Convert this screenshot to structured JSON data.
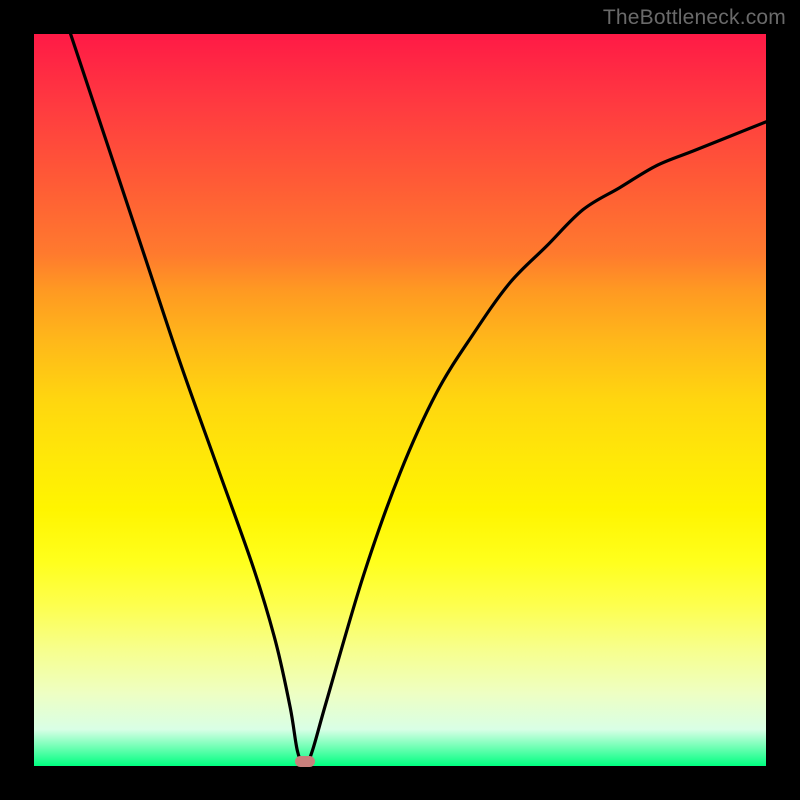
{
  "attribution": "TheBottleneck.com",
  "chart_data": {
    "type": "line",
    "title": "",
    "xlabel": "",
    "ylabel": "",
    "xlim": [
      0,
      100
    ],
    "ylim": [
      0,
      100
    ],
    "series": [
      {
        "name": "bottleneck-curve",
        "x": [
          5,
          10,
          15,
          20,
          25,
          30,
          33,
          35,
          36,
          37,
          38,
          40,
          45,
          50,
          55,
          60,
          65,
          70,
          75,
          80,
          85,
          90,
          95,
          100
        ],
        "values": [
          100,
          85,
          70,
          55,
          41,
          27,
          17,
          8,
          2,
          0,
          2,
          9,
          26,
          40,
          51,
          59,
          66,
          71,
          76,
          79,
          82,
          84,
          86,
          88
        ]
      }
    ],
    "marker": {
      "x": 37,
      "y": 0
    },
    "background_gradient": {
      "top": "#ff1a46",
      "mid": "#fff500",
      "bottom": "#00ff80"
    }
  }
}
